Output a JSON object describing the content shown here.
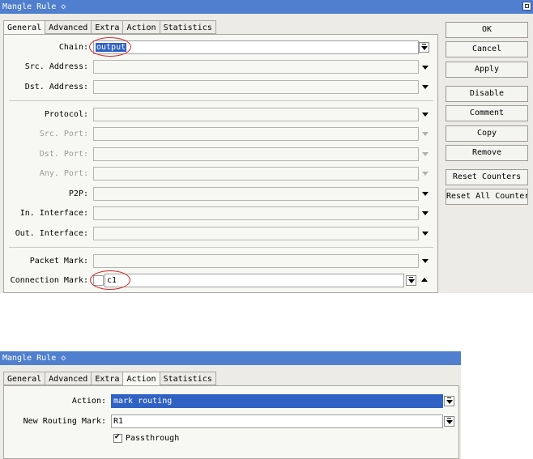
{
  "top": {
    "title": "Mangle Rule ◇",
    "tabs": [
      "General",
      "Advanced",
      "Extra",
      "Action",
      "Statistics"
    ],
    "active_tab": "General",
    "fields": {
      "chain": {
        "label": "Chain:",
        "value": "output"
      },
      "src_address": {
        "label": "Src. Address:",
        "value": ""
      },
      "dst_address": {
        "label": "Dst. Address:",
        "value": ""
      },
      "protocol": {
        "label": "Protocol:",
        "value": ""
      },
      "src_port": {
        "label": "Src. Port:",
        "value": ""
      },
      "dst_port": {
        "label": "Dst. Port:",
        "value": ""
      },
      "any_port": {
        "label": "Any. Port:",
        "value": ""
      },
      "p2p": {
        "label": "P2P:",
        "value": ""
      },
      "in_interface": {
        "label": "In. Interface:",
        "value": ""
      },
      "out_interface": {
        "label": "Out. Interface:",
        "value": ""
      },
      "packet_mark": {
        "label": "Packet Mark:",
        "value": ""
      },
      "connection_mark": {
        "label": "Connection Mark:",
        "value": "c1"
      }
    },
    "buttons": {
      "ok": "OK",
      "cancel": "Cancel",
      "apply": "Apply",
      "disable": "Disable",
      "comment": "Comment",
      "copy": "Copy",
      "remove": "Remove",
      "reset_counters": "Reset Counters",
      "reset_all_counters": "Reset All Counters"
    }
  },
  "bottom": {
    "title": "Mangle Rule ◇",
    "tabs": [
      "General",
      "Advanced",
      "Extra",
      "Action",
      "Statistics"
    ],
    "active_tab": "Action",
    "fields": {
      "action": {
        "label": "Action:",
        "value": "mark routing"
      },
      "new_routing_mark": {
        "label": "New Routing Mark:",
        "value": "R1"
      }
    },
    "passthrough": {
      "label": "Passthrough",
      "checked": true
    }
  },
  "colors": {
    "titlebar": "#4f7fce",
    "selection": "#2f62c4",
    "highlight_circle": "#d12a2a"
  }
}
